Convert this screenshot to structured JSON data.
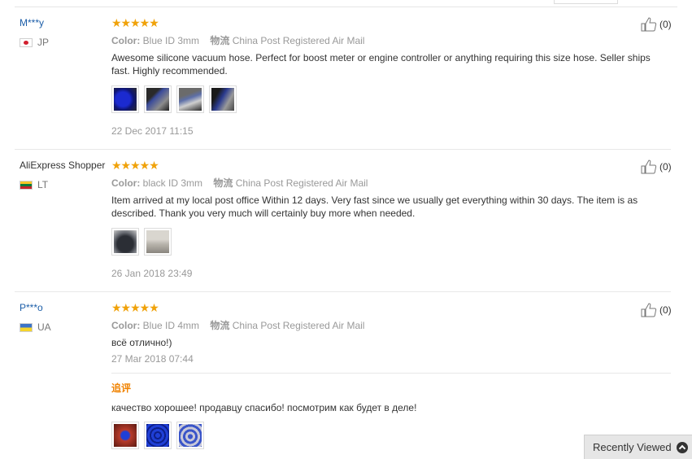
{
  "reviews": [
    {
      "user": "M***y",
      "country": "JP",
      "stars": "★★★★★",
      "color_label": "Color:",
      "color_value": "Blue ID 3mm",
      "ship_label": "物流",
      "ship_value": "China Post Registered Air Mail",
      "text": "Awesome silicone vacuum hose. Perfect for boost meter or engine controller or anything requiring this size hose. Seller ships fast. Highly recommended.",
      "date": "22 Dec 2017 11:15",
      "likes": "(0)",
      "thumb_colors": [
        "#1b2ad0",
        "#3a4b9a",
        "#5d6fa8",
        "#2a3a8e"
      ]
    },
    {
      "user": "AliExpress Shopper",
      "country": "LT",
      "stars": "★★★★★",
      "color_label": "Color:",
      "color_value": "black ID 3mm",
      "ship_label": "物流",
      "ship_value": "China Post Registered Air Mail",
      "text": "Item arrived at my local post office Within 12 days. Very fast since we usually get everything within 30 days. The item is as described. Thank you very much will certainly buy more when needed.",
      "date": "26 Jan 2018 23:49",
      "likes": "(0)",
      "thumb_colors": [
        "#2b2e35",
        "#b9b5ad"
      ]
    },
    {
      "user": "P***o",
      "country": "UA",
      "stars": "★★★★★",
      "color_label": "Color:",
      "color_value": "Blue ID 4mm",
      "ship_label": "物流",
      "ship_value": "China Post Registered Air Mail",
      "text": "всё отлично!)",
      "date": "27 Mar 2018 07:44",
      "likes": "(0)",
      "followup_label": "追评",
      "followup_text": "качество хорошее! продавцу спасибо! посмотрим как будет в деле!",
      "thumb_colors": [
        "#b83a2a",
        "#1f3fd6",
        "#3a55c9"
      ]
    }
  ],
  "footer": {
    "recently_viewed": "Recently Viewed"
  }
}
